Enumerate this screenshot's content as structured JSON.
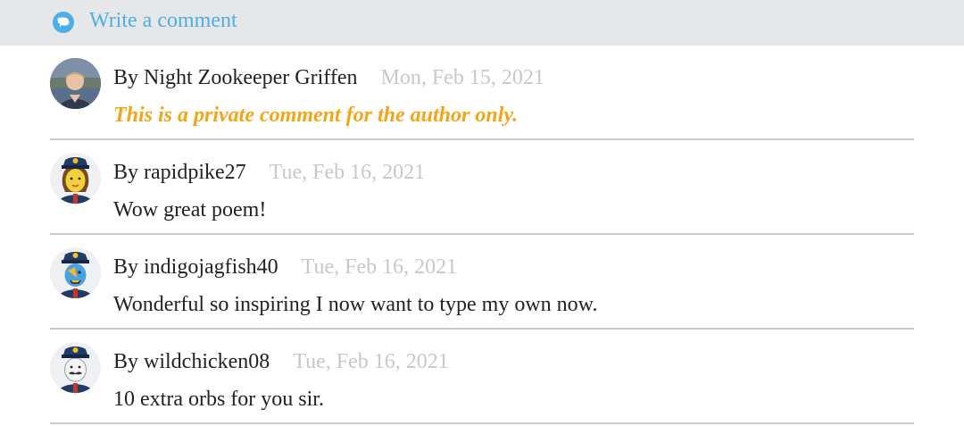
{
  "write_bar": {
    "label": "Write a comment",
    "icon": "comment-bubble-icon",
    "accent": "#4eaee6"
  },
  "comments": [
    {
      "author": "By Night Zookeeper Griffen",
      "date": "Mon, Feb 15, 2021",
      "text": "This is a private comment for the author only.",
      "private": true,
      "avatar_icon": "photo-avatar"
    },
    {
      "author": "By rapidpike27",
      "date": "Tue, Feb 16, 2021",
      "text": "Wow great poem!",
      "private": false,
      "avatar_icon": "zookeeper-girl-avatar"
    },
    {
      "author": "By indigojagfish40",
      "date": "Tue, Feb 16, 2021",
      "text": "Wonderful so inspiring I now want to type my own now.",
      "private": false,
      "avatar_icon": "zookeeper-blue-avatar"
    },
    {
      "author": "By wildchicken08",
      "date": "Tue, Feb 16, 2021",
      "text": "10 extra orbs for you sir.",
      "private": false,
      "avatar_icon": "zookeeper-moustache-avatar"
    }
  ],
  "colors": {
    "private_text": "#f3a516",
    "date_text": "#c8c8c8",
    "divider": "#c9c9c9",
    "bar_background": "#e6e7e9"
  }
}
